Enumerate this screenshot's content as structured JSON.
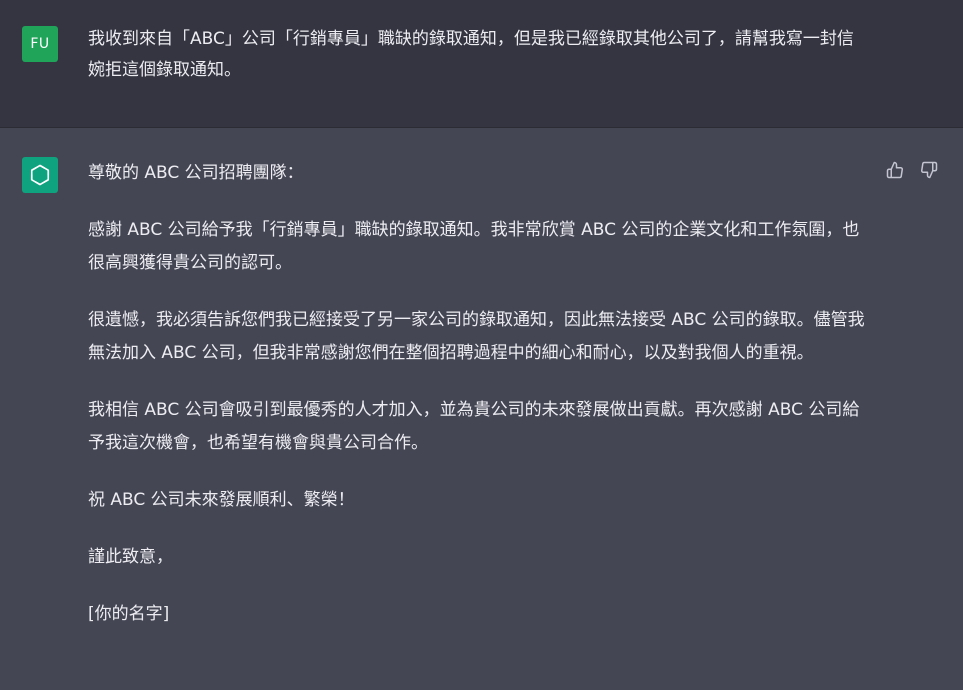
{
  "user": {
    "avatar_initials": "FU",
    "avatar_color": "#1fa45a",
    "message": "我收到來自「ABC」公司「行銷專員」職缺的錄取通知，但是我已經錄取其他公司了，請幫我寫一封信婉拒這個錄取通知。"
  },
  "assistant": {
    "avatar_icon": "openai-logo-icon",
    "avatar_color": "#10a37f",
    "paragraphs": [
      "尊敬的 ABC 公司招聘團隊：",
      "感謝 ABC 公司給予我「行銷專員」職缺的錄取通知。我非常欣賞 ABC 公司的企業文化和工作氛圍，也很高興獲得貴公司的認可。",
      "很遺憾，我必須告訴您們我已經接受了另一家公司的錄取通知，因此無法接受 ABC 公司的錄取。儘管我無法加入 ABC 公司，但我非常感謝您們在整個招聘過程中的細心和耐心，以及對我個人的重視。",
      "我相信 ABC 公司會吸引到最優秀的人才加入，並為貴公司的未來發展做出貢獻。再次感謝 ABC 公司給予我這次機會，也希望有機會與貴公司合作。",
      "祝 ABC 公司未來發展順利、繁榮！",
      "謹此致意，",
      "[你的名字]"
    ],
    "feedback": {
      "thumbs_up_icon": "thumbs-up-icon",
      "thumbs_down_icon": "thumbs-down-icon"
    }
  }
}
